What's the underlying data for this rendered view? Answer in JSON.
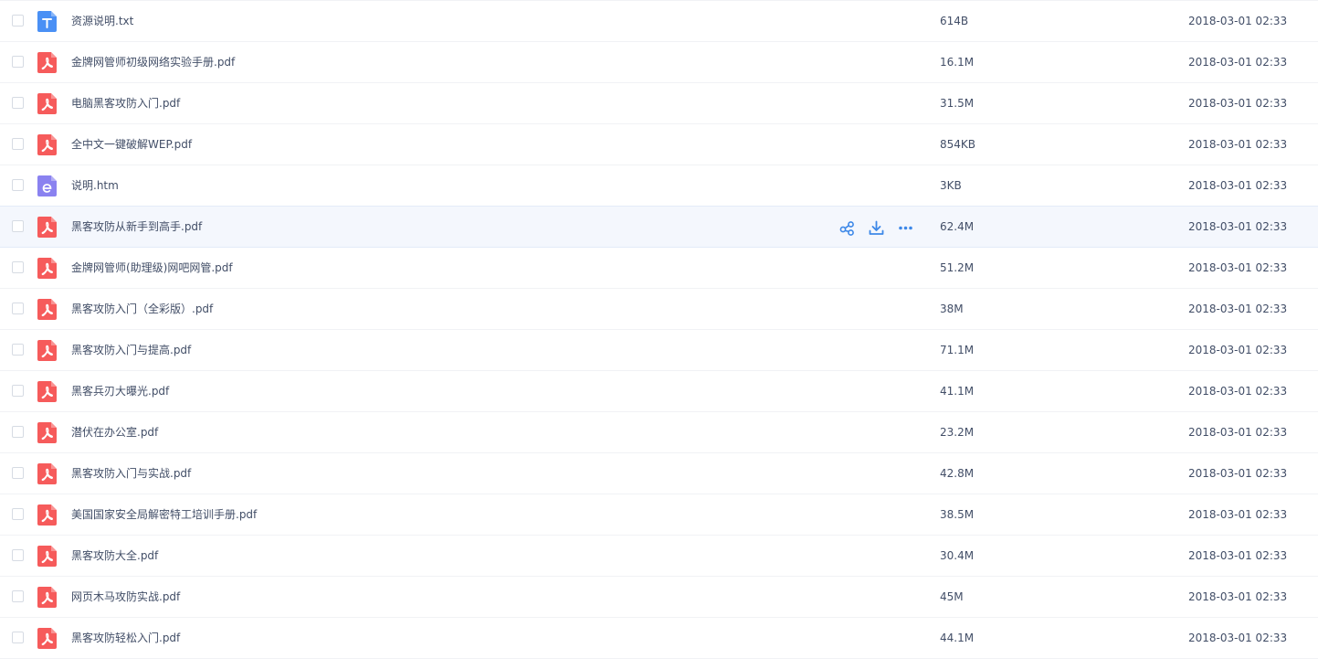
{
  "colors": {
    "pdf_icon": "#f65b5b",
    "txt_icon": "#4a90f5",
    "htm_icon": "#8a82f0",
    "action_icon": "#3d88e8",
    "text": "#424e67",
    "row_hover": "#f4f7fd"
  },
  "files": [
    {
      "name": "资源说明.txt",
      "size": "614B",
      "time": "2018-03-01 02:33",
      "icon": "txt-file-icon"
    },
    {
      "name": "金牌网管师初级网络实验手册.pdf",
      "size": "16.1M",
      "time": "2018-03-01 02:33",
      "icon": "pdf-file-icon"
    },
    {
      "name": "电脑黑客攻防入门.pdf",
      "size": "31.5M",
      "time": "2018-03-01 02:33",
      "icon": "pdf-file-icon"
    },
    {
      "name": "全中文一键破解WEP.pdf",
      "size": "854KB",
      "time": "2018-03-01 02:33",
      "icon": "pdf-file-icon"
    },
    {
      "name": "说明.htm",
      "size": "3KB",
      "time": "2018-03-01 02:33",
      "icon": "htm-file-icon"
    },
    {
      "name": "黑客攻防从新手到高手.pdf",
      "size": "62.4M",
      "time": "2018-03-01 02:33",
      "icon": "pdf-file-icon",
      "hover": true
    },
    {
      "name": "金牌网管师(助理级)网吧网管.pdf",
      "size": "51.2M",
      "time": "2018-03-01 02:33",
      "icon": "pdf-file-icon"
    },
    {
      "name": "黑客攻防入门（全彩版）.pdf",
      "size": "38M",
      "time": "2018-03-01 02:33",
      "icon": "pdf-file-icon"
    },
    {
      "name": "黑客攻防入门与提高.pdf",
      "size": "71.1M",
      "time": "2018-03-01 02:33",
      "icon": "pdf-file-icon"
    },
    {
      "name": "黑客兵刃大曝光.pdf",
      "size": "41.1M",
      "time": "2018-03-01 02:33",
      "icon": "pdf-file-icon"
    },
    {
      "name": "潜伏在办公室.pdf",
      "size": "23.2M",
      "time": "2018-03-01 02:33",
      "icon": "pdf-file-icon"
    },
    {
      "name": "黑客攻防入门与实战.pdf",
      "size": "42.8M",
      "time": "2018-03-01 02:33",
      "icon": "pdf-file-icon"
    },
    {
      "name": "美国国家安全局解密特工培训手册.pdf",
      "size": "38.5M",
      "time": "2018-03-01 02:33",
      "icon": "pdf-file-icon"
    },
    {
      "name": "黑客攻防大全.pdf",
      "size": "30.4M",
      "time": "2018-03-01 02:33",
      "icon": "pdf-file-icon"
    },
    {
      "name": "网页木马攻防实战.pdf",
      "size": "45M",
      "time": "2018-03-01 02:33",
      "icon": "pdf-file-icon"
    },
    {
      "name": "黑客攻防轻松入门.pdf",
      "size": "44.1M",
      "time": "2018-03-01 02:33",
      "icon": "pdf-file-icon"
    }
  ],
  "row_actions": [
    {
      "icon": "share-icon"
    },
    {
      "icon": "download-icon"
    },
    {
      "icon": "more-icon"
    }
  ]
}
